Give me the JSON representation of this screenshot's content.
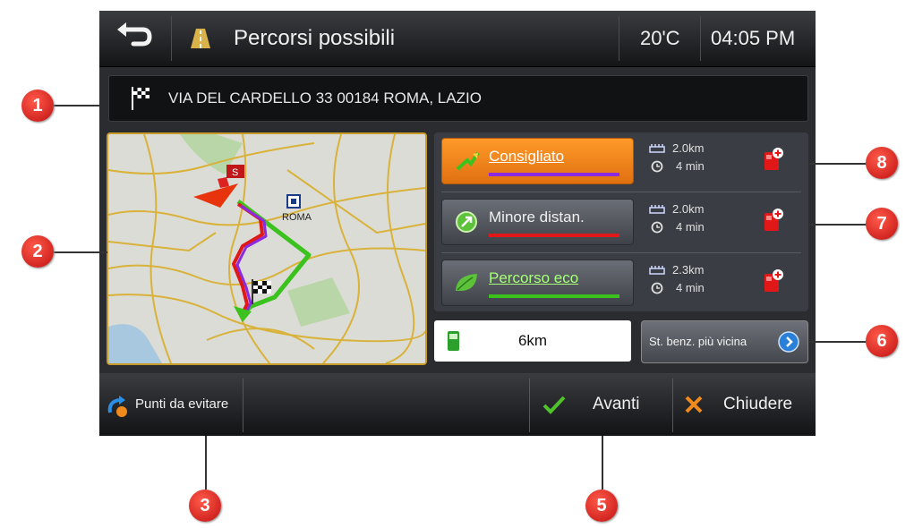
{
  "header": {
    "title": "Percorsi possibili",
    "temperature": "20'C",
    "time": "04:05 PM",
    "back_icon": "back-arrow-icon",
    "road_icon": "road-icon"
  },
  "destination": {
    "address": "VIA DEL CARDELLO 33 00184 ROMA, LAZIO",
    "icon": "checkered-flag-icon"
  },
  "map": {
    "city_label": "ROMA"
  },
  "routes": [
    {
      "label": "Consigliato",
      "distance": "2.0km",
      "time": "4 min",
      "line_color": "#8a2be2",
      "selected": true
    },
    {
      "label": "Minore distan.",
      "distance": "2.0km",
      "time": "4 min",
      "line_color": "#e01818",
      "selected": false
    },
    {
      "label": "Percorso eco",
      "distance": "2.3km",
      "time": "4 min",
      "line_color": "#3cc21e",
      "selected": false
    }
  ],
  "fuel": {
    "range": "6km"
  },
  "gas_station": {
    "label": "St. benz. più vicina"
  },
  "bottom": {
    "avoid_label": "Punti da evitare",
    "next_label": "Avanti",
    "close_label": "Chiudere"
  },
  "callouts": [
    "1",
    "2",
    "3",
    "5",
    "6",
    "7",
    "8"
  ],
  "colors": {
    "selected_route": "#f08a1c",
    "accent_blue": "#2a7fd8",
    "callout_red": "#d81a1a"
  }
}
